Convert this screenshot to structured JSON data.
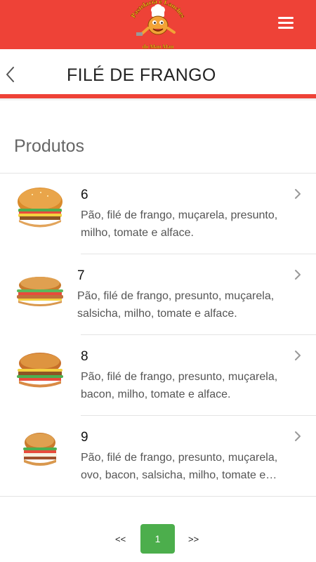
{
  "header": {
    "logo_text": "Pastelaria e Lanches do Mau Mau",
    "menu_icon": "hamburger-menu-icon"
  },
  "titlebar": {
    "title": "FILÉ DE FRANGO",
    "back_icon": "chevron-left-icon"
  },
  "colors": {
    "brand_red": "#ee4237",
    "pagination_active": "#4cae4c"
  },
  "section": {
    "title": "Produtos"
  },
  "products": [
    {
      "name": "6",
      "description": "Pão, filé de frango, muçarela, presunto, milho, tomate e alface."
    },
    {
      "name": "7",
      "description": "Pão, filé de frango, presunto, muçarela, salsicha, milho, tomate e alface."
    },
    {
      "name": "8",
      "description": "Pão, filé de frango, presunto, muçarela, bacon, milho, tomate e alface."
    },
    {
      "name": "9",
      "description": "Pão, filé de frango, presunto, muçarela, ovo, bacon, salsicha, milho, tomate e alface."
    }
  ],
  "pagination": {
    "prev_label": "<<",
    "current_page": "1",
    "next_label": ">>"
  }
}
